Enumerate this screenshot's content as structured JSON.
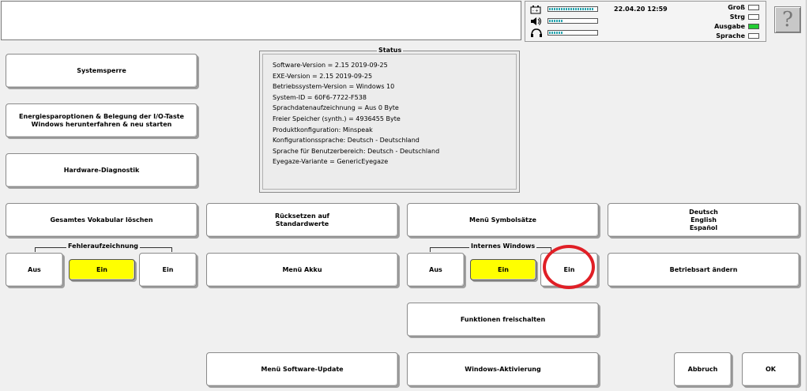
{
  "header": {
    "datetime": "22.04.20 12:59",
    "indicators": [
      {
        "label": "Groß",
        "on": false
      },
      {
        "label": "Strg",
        "on": false
      },
      {
        "label": "Ausgabe",
        "on": true
      },
      {
        "label": "Sprache",
        "on": false
      }
    ],
    "meters": [
      {
        "icon": "battery-icon",
        "level": 0.95
      },
      {
        "icon": "speaker-icon",
        "level": 0.3
      },
      {
        "icon": "headphones-icon",
        "level": 0.3
      }
    ],
    "help_label": "?"
  },
  "status": {
    "title": "Status",
    "lines": [
      "Software-Version = 2.15 2019-09-25",
      "EXE-Version = 2.15 2019-09-25",
      "Betriebssystem-Version = Windows 10",
      "System-ID = 60F6-7722-F538",
      "Sprachdatenaufzeichnung = Aus 0 Byte",
      "Freier Speicher (synth.) = 4936455 Byte",
      "Produktkonfiguration:  Minspeak",
      "Konfigurationssprache: Deutsch - Deutschland",
      "Sprache für Benutzerbereich: Deutsch - Deutschland",
      "Eyegaze-Variante =  GenericEyegaze"
    ]
  },
  "buttons": {
    "systemsperre": "Systemsperre",
    "energie": "Energiesparoptionen & Belegung der I/O-Taste\nWindows herunterfahren & neu starten",
    "hardware": "Hardware-Diagnostik",
    "vokabular": "Gesamtes Vokabular löschen",
    "ruecksetzen": "Rücksetzen auf\nStandardwerte",
    "symbolsaetze": "Menü Symbolsätze",
    "sprachen": "Deutsch\nEnglish\nEspañol",
    "akku": "Menü Akku",
    "betriebsart": "Betriebsart ändern",
    "freischalten": "Funktionen freischalten",
    "software_update": "Menü Software-Update",
    "windows_aktivierung": "Windows-Aktivierung",
    "abbruch": "Abbruch",
    "ok": "OK"
  },
  "fehleraufzeichnung": {
    "label": "Fehleraufzeichnung",
    "aus": "Aus",
    "ein_active": "Ein",
    "ein": "Ein"
  },
  "internes_windows": {
    "label": "Internes Windows",
    "aus": "Aus",
    "ein_active": "Ein",
    "ein": "Ein"
  },
  "colors": {
    "active": "#ffff00",
    "indicator_on": "#22cc33",
    "annotation": "#e01f26"
  }
}
